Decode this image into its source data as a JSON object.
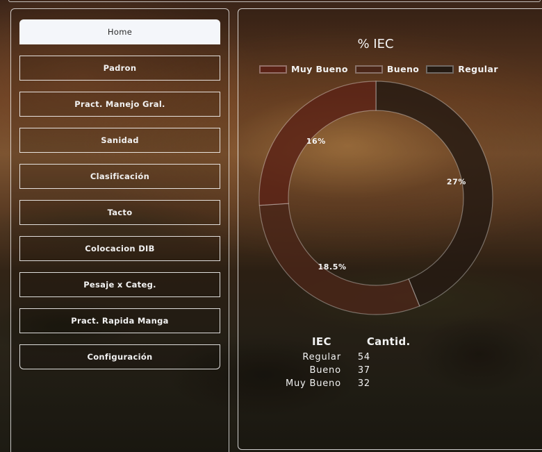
{
  "sidebar": {
    "items": [
      {
        "label": "Home",
        "active": true
      },
      {
        "label": "Padron",
        "active": false
      },
      {
        "label": "Pract. Manejo Gral.",
        "active": false
      },
      {
        "label": "Sanidad",
        "active": false
      },
      {
        "label": "Clasificación",
        "active": false
      },
      {
        "label": "Tacto",
        "active": false
      },
      {
        "label": "Colocacion DIB",
        "active": false
      },
      {
        "label": "Pesaje x Categ.",
        "active": false
      },
      {
        "label": "Pract. Rapida Manga",
        "active": false
      },
      {
        "label": "Configuración",
        "active": false
      }
    ]
  },
  "colors": {
    "muy_bueno": "#5a2216",
    "bueno": "#4a2618",
    "regular": "#241a12",
    "active_nav_bg": "#f4f6fa"
  },
  "chart_data": {
    "type": "pie",
    "variant": "donut",
    "title": "% IEC",
    "legend_position": "top",
    "categories": [
      "Muy Bueno",
      "Bueno",
      "Regular"
    ],
    "values": [
      32,
      37,
      54
    ],
    "slice_labels": [
      "16%",
      "18.5%",
      "27%"
    ],
    "colors": [
      "#5a2216",
      "#4a2618",
      "#241a12"
    ]
  },
  "table": {
    "headers": [
      "IEC",
      "Cantid."
    ],
    "rows": [
      {
        "label": "Regular",
        "value": "54"
      },
      {
        "label": "Bueno",
        "value": "37"
      },
      {
        "label": "Muy Bueno",
        "value": "32"
      }
    ]
  }
}
